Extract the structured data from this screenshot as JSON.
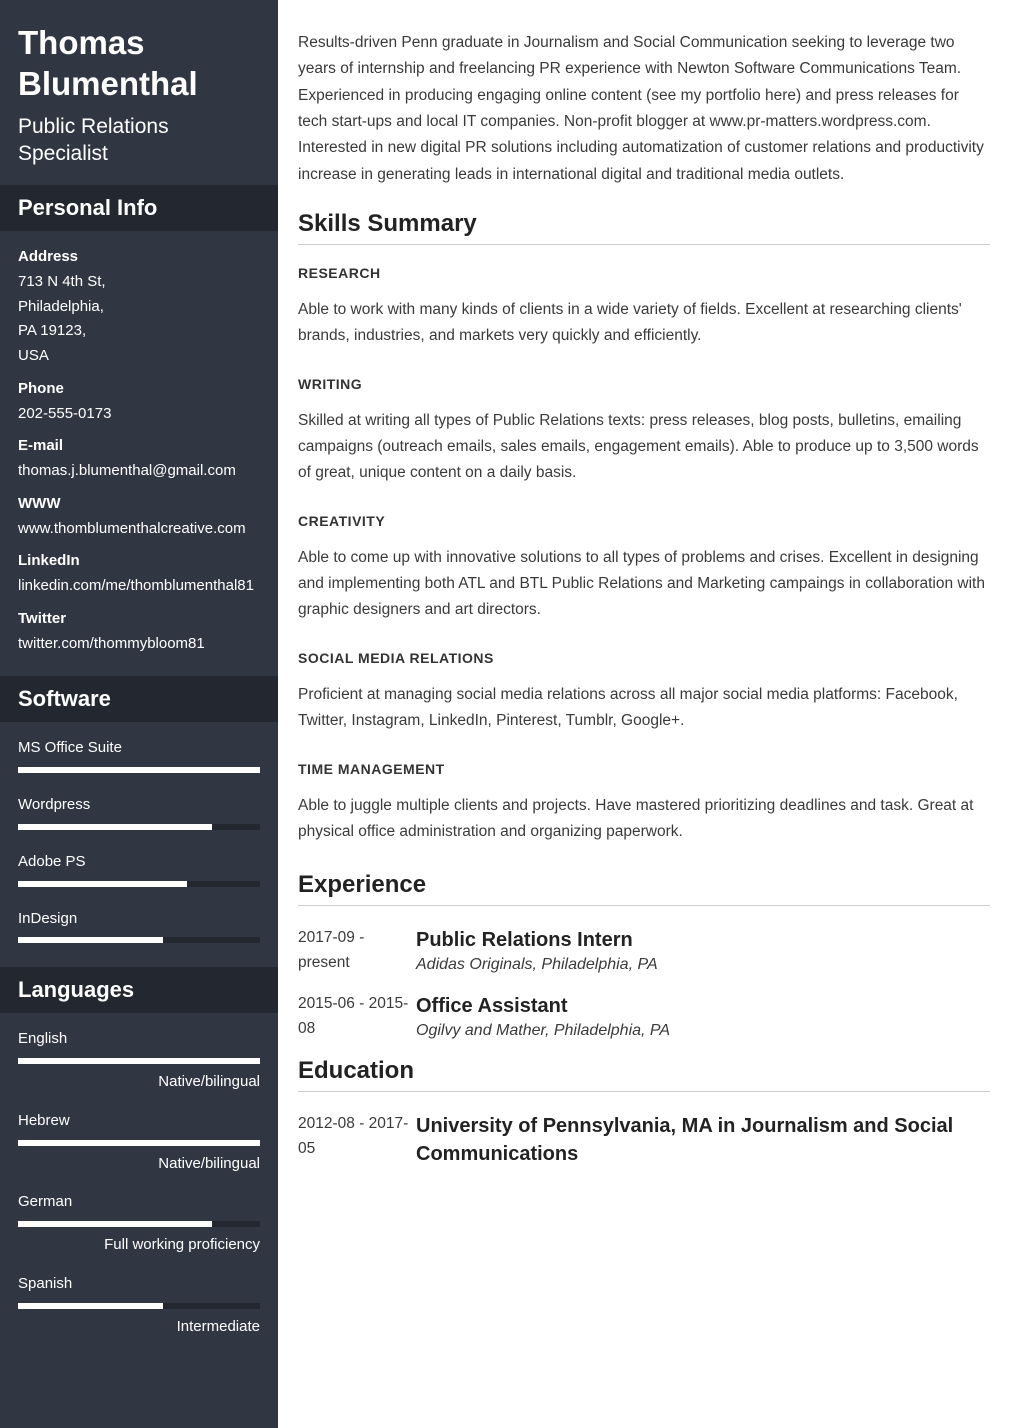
{
  "name": "Thomas Blumenthal",
  "job_title": "Public Relations Specialist",
  "sidebar": {
    "personal_info_header": "Personal Info",
    "info": [
      {
        "label": "Address",
        "value": "713 N 4th St,\nPhiladelphia,\nPA 19123,\nUSA"
      },
      {
        "label": "Phone",
        "value": "202-555-0173"
      },
      {
        "label": "E-mail",
        "value": "thomas.j.blumenthal@gmail.com"
      },
      {
        "label": "WWW",
        "value": "www.thomblumenthalcreative.com"
      },
      {
        "label": "LinkedIn",
        "value": "linkedin.com/me/thomblumenthal81"
      },
      {
        "label": "Twitter",
        "value": "twitter.com/thommybloom81"
      }
    ],
    "software_header": "Software",
    "software": [
      {
        "name": "MS Office Suite",
        "pct": 100
      },
      {
        "name": "Wordpress",
        "pct": 80
      },
      {
        "name": "Adobe PS",
        "pct": 70
      },
      {
        "name": "InDesign",
        "pct": 60
      }
    ],
    "languages_header": "Languages",
    "languages": [
      {
        "name": "English",
        "pct": 100,
        "level": "Native/bilingual"
      },
      {
        "name": "Hebrew",
        "pct": 100,
        "level": "Native/bilingual"
      },
      {
        "name": "German",
        "pct": 80,
        "level": "Full working proficiency"
      },
      {
        "name": "Spanish",
        "pct": 60,
        "level": "Intermediate"
      }
    ]
  },
  "main": {
    "summary": "Results-driven Penn graduate in Journalism and Social Communication seeking to leverage two years of internship and freelancing PR experience with Newton Software Communications Team. Experienced in producing engaging online content (see my portfolio here) and press releases for tech start-ups and local IT companies. Non-profit blogger at www.pr-matters.wordpress.com. Interested in new digital PR solutions including automatization of customer relations and productivity increase in generating leads in international digital and traditional media outlets.",
    "skills_header": "Skills Summary",
    "skills": [
      {
        "heading": "RESEARCH",
        "desc": "Able to work with many kinds of clients in a wide variety of fields. Excellent at researching clients' brands, industries, and markets very quickly and efficiently."
      },
      {
        "heading": "WRITING",
        "desc": "Skilled at writing all types of Public Relations texts: press releases, blog posts, bulletins, emailing campaigns (outreach emails, sales emails, engagement emails). Able to produce up to 3,500 words of great, unique content on a daily basis."
      },
      {
        "heading": "CREATIVITY",
        "desc": "Able to come up with innovative solutions to all types of problems and crises. Excellent in designing and implementing both ATL and BTL Public Relations and Marketing campaings in collaboration with graphic designers and art directors."
      },
      {
        "heading": "SOCIAL MEDIA RELATIONS",
        "desc": "Proficient at managing social media relations across all major social media platforms: Facebook, Twitter, Instagram, LinkedIn, Pinterest, Tumblr, Google+."
      },
      {
        "heading": "TIME MANAGEMENT",
        "desc": "Able to juggle multiple clients and projects. Have mastered prioritizing deadlines and task. Great at physical office administration and organizing paperwork."
      }
    ],
    "experience_header": "Experience",
    "experience": [
      {
        "dates": "2017-09 - present",
        "title": "Public Relations Intern",
        "company": "Adidas Originals, Philadelphia, PA"
      },
      {
        "dates": "2015-06 - 2015-08",
        "title": "Office Assistant",
        "company": "Ogilvy and Mather, Philadelphia, PA"
      }
    ],
    "education_header": "Education",
    "education": [
      {
        "dates": "2012-08 - 2017-05",
        "title": "University of Pennsylvania, MA in Journalism and Social Communications"
      }
    ]
  }
}
